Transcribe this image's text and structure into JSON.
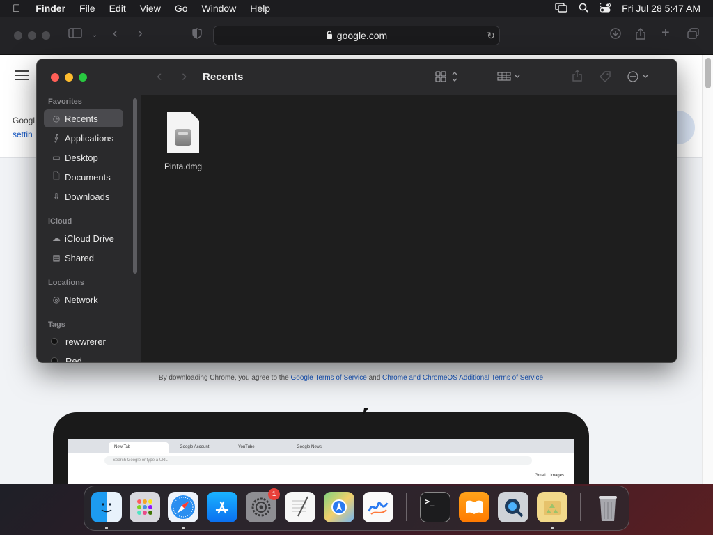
{
  "menubar": {
    "app_name": "Finder",
    "items": [
      "File",
      "Edit",
      "View",
      "Go",
      "Window",
      "Help"
    ],
    "clock": "Fri Jul 28  5:47 AM"
  },
  "safari": {
    "url": "google.com"
  },
  "webpage": {
    "google_text": "Googl",
    "settings_text": "settin",
    "terms_prefix": "By downloading Chrome, you agree to the ",
    "terms_link1": "Google Terms of Service",
    "terms_and": " and ",
    "terms_link2": "Chrome and ChromeOS Additional Terms of Service",
    "mini_browser": {
      "tabs": [
        "New Tab",
        "Google Account",
        "YouTube",
        "Google News"
      ],
      "url_placeholder": "Search Google or type a URL",
      "links": [
        "Gmail",
        "Images"
      ]
    }
  },
  "finder": {
    "title": "Recents",
    "sidebar": {
      "favorites_label": "Favorites",
      "favorites": [
        {
          "label": "Recents",
          "icon": "clock-icon"
        },
        {
          "label": "Applications",
          "icon": "applications-icon"
        },
        {
          "label": "Desktop",
          "icon": "desktop-icon"
        },
        {
          "label": "Documents",
          "icon": "document-icon"
        },
        {
          "label": "Downloads",
          "icon": "download-icon"
        }
      ],
      "icloud_label": "iCloud",
      "icloud": [
        {
          "label": "iCloud Drive",
          "icon": "cloud-icon"
        },
        {
          "label": "Shared",
          "icon": "shared-folder-icon"
        }
      ],
      "locations_label": "Locations",
      "locations": [
        {
          "label": "Network",
          "icon": "globe-icon"
        }
      ],
      "tags_label": "Tags",
      "tags": [
        {
          "label": "rewwrerer",
          "color": "#111111"
        },
        {
          "label": "Red",
          "color": "#111111"
        }
      ]
    },
    "files": [
      {
        "name": "Pinta.dmg",
        "icon": "disk-image-icon"
      }
    ]
  },
  "dock": {
    "apps": [
      {
        "name": "Finder",
        "icon": "finder-icon"
      },
      {
        "name": "Launchpad",
        "icon": "launchpad-icon"
      },
      {
        "name": "Safari",
        "icon": "safari-icon"
      },
      {
        "name": "App Store",
        "icon": "app-store-icon"
      },
      {
        "name": "System Settings",
        "icon": "settings-icon",
        "badge": "1"
      },
      {
        "name": "TextEdit",
        "icon": "textedit-icon"
      },
      {
        "name": "Maps",
        "icon": "maps-icon"
      },
      {
        "name": "Freeform",
        "icon": "freeform-icon"
      },
      {
        "name": "Terminal",
        "icon": "terminal-icon"
      },
      {
        "name": "Books",
        "icon": "books-icon"
      },
      {
        "name": "QuickTime Player",
        "icon": "quicktime-icon"
      },
      {
        "name": "Archive Utility",
        "icon": "archive-icon"
      },
      {
        "name": "Trash",
        "icon": "trash-icon"
      }
    ]
  }
}
